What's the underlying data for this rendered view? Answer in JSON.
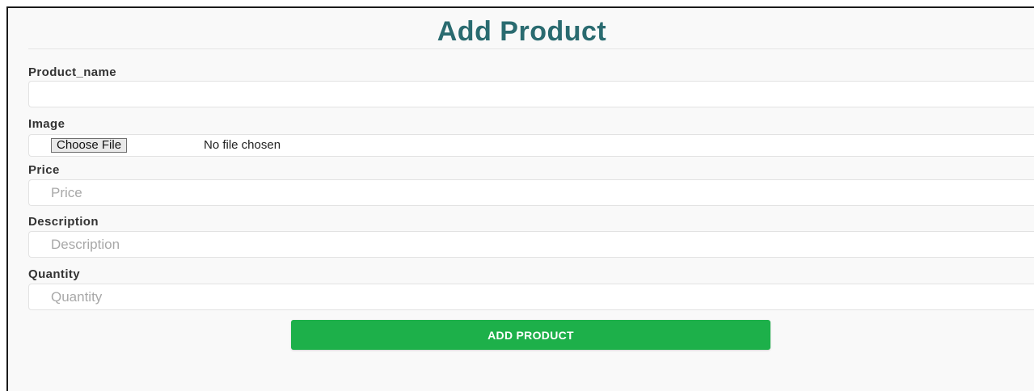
{
  "form": {
    "title": "Add Product",
    "fields": {
      "product_name": {
        "label": "Product_name",
        "value": "",
        "placeholder": ""
      },
      "image": {
        "label": "Image",
        "button_label": "Choose File",
        "status": "No file chosen"
      },
      "price": {
        "label": "Price",
        "value": "",
        "placeholder": "Price"
      },
      "description": {
        "label": "Description",
        "value": "",
        "placeholder": "Description"
      },
      "quantity": {
        "label": "Quantity",
        "value": "",
        "placeholder": "Quantity"
      }
    },
    "submit_label": "ADD PRODUCT"
  },
  "colors": {
    "title": "#2a6b70",
    "submit_button": "#1db04a",
    "background": "#f9f9f9"
  }
}
